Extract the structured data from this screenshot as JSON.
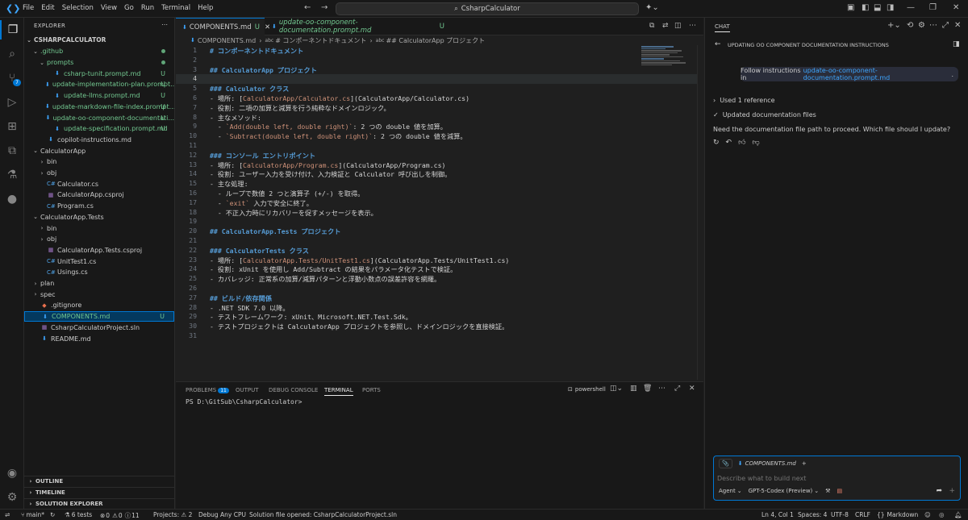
{
  "titlebar": {
    "menu": [
      "File",
      "Edit",
      "Selection",
      "View",
      "Go",
      "Run",
      "Terminal",
      "Help"
    ],
    "search": "CsharpCalculator"
  },
  "sidebar": {
    "title": "EXPLORER",
    "project": "CSHARPCALCULATOR",
    "items": [
      {
        "label": ".github",
        "depth": 1,
        "type": "folder",
        "open": true,
        "git": "dot"
      },
      {
        "label": "prompts",
        "depth": 2,
        "type": "folder",
        "open": true,
        "git": "dot"
      },
      {
        "label": "csharp-tunit.prompt.md",
        "depth": 3,
        "type": "md",
        "git": "U"
      },
      {
        "label": "update-implementation-plan.prompt....",
        "depth": 3,
        "type": "md",
        "git": "U"
      },
      {
        "label": "update-llms.prompt.md",
        "depth": 3,
        "type": "md",
        "git": "U"
      },
      {
        "label": "update-markdown-file-index.prompt....",
        "depth": 3,
        "type": "md",
        "git": "U"
      },
      {
        "label": "update-oo-component-documentati...",
        "depth": 3,
        "type": "md",
        "git": "U"
      },
      {
        "label": "update-specification.prompt.md",
        "depth": 3,
        "type": "md",
        "git": "U"
      },
      {
        "label": "copilot-instructions.md",
        "depth": 2,
        "type": "md",
        "git": ""
      },
      {
        "label": "CalculatorApp",
        "depth": 1,
        "type": "folder",
        "open": true,
        "git": ""
      },
      {
        "label": "bin",
        "depth": 2,
        "type": "folder",
        "open": false,
        "git": ""
      },
      {
        "label": "obj",
        "depth": 2,
        "type": "folder",
        "open": false,
        "git": ""
      },
      {
        "label": "Calculator.cs",
        "depth": 2,
        "type": "cs",
        "git": ""
      },
      {
        "label": "CalculatorApp.csproj",
        "depth": 2,
        "type": "proj",
        "git": ""
      },
      {
        "label": "Program.cs",
        "depth": 2,
        "type": "cs",
        "git": ""
      },
      {
        "label": "CalculatorApp.Tests",
        "depth": 1,
        "type": "folder",
        "open": true,
        "git": ""
      },
      {
        "label": "bin",
        "depth": 2,
        "type": "folder",
        "open": false,
        "git": ""
      },
      {
        "label": "obj",
        "depth": 2,
        "type": "folder",
        "open": false,
        "git": ""
      },
      {
        "label": "CalculatorApp.Tests.csproj",
        "depth": 2,
        "type": "proj",
        "git": ""
      },
      {
        "label": "UnitTest1.cs",
        "depth": 2,
        "type": "cs",
        "git": ""
      },
      {
        "label": "Usings.cs",
        "depth": 2,
        "type": "cs",
        "git": ""
      },
      {
        "label": "plan",
        "depth": 1,
        "type": "folder",
        "open": false,
        "git": ""
      },
      {
        "label": "spec",
        "depth": 1,
        "type": "folder",
        "open": false,
        "git": ""
      },
      {
        "label": ".gitignore",
        "depth": 1,
        "type": "git",
        "git": ""
      },
      {
        "label": "COMPONENTS.md",
        "depth": 1,
        "type": "md",
        "git": "U",
        "selected": true
      },
      {
        "label": "CsharpCalculatorProject.sln",
        "depth": 1,
        "type": "sln",
        "git": ""
      },
      {
        "label": "README.md",
        "depth": 1,
        "type": "md",
        "git": ""
      }
    ],
    "sections": [
      "OUTLINE",
      "TIMELINE",
      "SOLUTION EXPLORER"
    ]
  },
  "tabs": [
    {
      "label": "COMPONENTS.md",
      "status": "U",
      "active": true
    },
    {
      "label": "update-oo-component-documentation.prompt.md",
      "status": "U",
      "active": false
    }
  ],
  "breadcrumb": [
    "COMPONENTS.md",
    "# コンポーネントドキュメント",
    "## CalculatorApp プロジェクト"
  ],
  "editor": {
    "lines": [
      [
        [
          "h",
          "# コンポーネントドキュメント"
        ]
      ],
      [],
      [
        [
          "h",
          "## CalculatorApp プロジェクト"
        ]
      ],
      [],
      [
        [
          "h",
          "### Calculator クラス"
        ]
      ],
      [
        [
          "txt",
          "- 場所: ["
        ],
        [
          "lnk",
          "CalculatorApp/Calculator.cs"
        ],
        [
          "txt",
          "]("
        ],
        [
          "txt",
          "CalculatorApp/Calculator.cs"
        ],
        [
          "txt",
          ")"
        ]
      ],
      [
        [
          "txt",
          "- 役割: 二項の加算と減算を行う純粋なドメインロジック。"
        ]
      ],
      [
        [
          "txt",
          "- 主なメソッド:"
        ]
      ],
      [
        [
          "txt",
          "  - "
        ],
        [
          "lnk",
          "`Add(double left, double right)`"
        ],
        [
          "txt",
          ": 2 つの double 値を加算。"
        ]
      ],
      [
        [
          "txt",
          "  - "
        ],
        [
          "lnk",
          "`Subtract(double left, double right)`"
        ],
        [
          "txt",
          ": 2 つの double 値を減算。"
        ]
      ],
      [],
      [
        [
          "h",
          "### コンソール エントリポイント"
        ]
      ],
      [
        [
          "txt",
          "- 場所: ["
        ],
        [
          "lnk",
          "CalculatorApp/Program.cs"
        ],
        [
          "txt",
          "]("
        ],
        [
          "txt",
          "CalculatorApp/Program.cs"
        ],
        [
          "txt",
          ")"
        ]
      ],
      [
        [
          "txt",
          "- 役割: ユーザー入力を受け付け、入力検証と Calculator 呼び出しを制御。"
        ]
      ],
      [
        [
          "txt",
          "- 主な処理:"
        ]
      ],
      [
        [
          "txt",
          "  - ループで数値 2 つと演算子 (+/-) を取得。"
        ]
      ],
      [
        [
          "txt",
          "  - "
        ],
        [
          "lnk",
          "`exit`"
        ],
        [
          "txt",
          " 入力で安全に終了。"
        ]
      ],
      [
        [
          "txt",
          "  - 不正入力時にリカバリーを促すメッセージを表示。"
        ]
      ],
      [],
      [
        [
          "h",
          "## CalculatorApp.Tests プロジェクト"
        ]
      ],
      [],
      [
        [
          "h",
          "### CalculatorTests クラス"
        ]
      ],
      [
        [
          "txt",
          "- 場所: ["
        ],
        [
          "lnk",
          "CalculatorApp.Tests/UnitTest1.cs"
        ],
        [
          "txt",
          "]("
        ],
        [
          "txt",
          "CalculatorApp.Tests/UnitTest1.cs"
        ],
        [
          "txt",
          ")"
        ]
      ],
      [
        [
          "txt",
          "- 役割: xUnit を使用し Add/Subtract の結果をパラメータ化テストで検証。"
        ]
      ],
      [
        [
          "txt",
          "- カバレッジ: 正常系の加算/減算パターンと浮動小数点の誤差許容を網羅。"
        ]
      ],
      [],
      [
        [
          "h",
          "## ビルド/依存関係"
        ]
      ],
      [
        [
          "txt",
          "- .NET SDK 7.0 以降。"
        ]
      ],
      [
        [
          "txt",
          "- テストフレームワーク: xUnit、Microsoft.NET.Test.Sdk。"
        ]
      ],
      [
        [
          "txt",
          "- テストプロジェクトは CalculatorApp プロジェクトを参照し、ドメインロジックを直接検証。"
        ]
      ],
      []
    ]
  },
  "panel": {
    "tabs": [
      "PROBLEMS",
      "OUTPUT",
      "DEBUG CONSOLE",
      "TERMINAL",
      "PORTS"
    ],
    "problems_count": "11",
    "active_tab": "TERMINAL",
    "shell": "powershell",
    "terminal_prompt": "PS D:\\GitSub\\CsharpCalculator>"
  },
  "chat": {
    "title": "CHAT",
    "session_title": "UPDATING OO COMPONENT DOCUMENTATION INSTRUCTIONS",
    "user_prefix": "Follow instructions in ",
    "user_link": "update-oo-component-documentation.prompt.md",
    "user_suffix": ".",
    "used_refs": "Used 1 reference",
    "updated_files": "Updated documentation files",
    "response": "Need the documentation file path to proceed. Which file should I update?",
    "attachment": "COMPONENTS.md",
    "input_placeholder": "Describe what to build next",
    "mode": "Agent",
    "model": "GPT-5-Codex (Preview)"
  },
  "statusbar": {
    "branch": "main*",
    "tests": "6 tests",
    "errors": "0",
    "warnings": "0",
    "infos": "11",
    "projects": "Projects: ⚠ 2",
    "debug": "Debug Any CPU",
    "solution": "Solution file opened: CsharpCalculatorProject.sln",
    "position": "Ln 4, Col 1",
    "spaces": "Spaces: 4",
    "encoding": "UTF-8",
    "eol": "CRLF",
    "language": "Markdown"
  },
  "colors": {
    "accent": "#0078d4",
    "git_untracked": "#73c991",
    "heading": "#569cd6",
    "link": "#ce9178"
  }
}
